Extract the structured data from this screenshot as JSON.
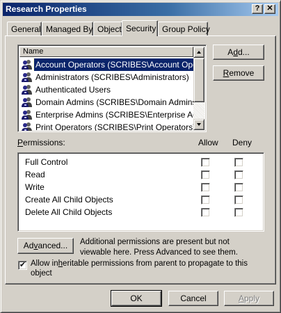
{
  "window": {
    "title": "Research Properties",
    "help_btn": "?",
    "close_btn": "✕"
  },
  "tabs": [
    {
      "label": "General",
      "active": false
    },
    {
      "label": "Managed By",
      "active": false
    },
    {
      "label": "Object",
      "active": false
    },
    {
      "label": "Security",
      "active": true
    },
    {
      "label": "Group Policy",
      "active": false
    }
  ],
  "name_list": {
    "header": "Name",
    "items": [
      {
        "label": "Account Operators (SCRIBES\\Account Opera...",
        "icon": "group-icon",
        "selected": true
      },
      {
        "label": "Administrators (SCRIBES\\Administrators)",
        "icon": "group-icon",
        "selected": false
      },
      {
        "label": "Authenticated Users",
        "icon": "group-icon",
        "selected": false
      },
      {
        "label": "Domain Admins (SCRIBES\\Domain Admins)",
        "icon": "group-icon",
        "selected": false
      },
      {
        "label": "Enterprise Admins (SCRIBES\\Enterprise Admins)",
        "icon": "group-icon",
        "selected": false
      },
      {
        "label": "Print Operators (SCRIBES\\Print Operators)",
        "icon": "group-icon",
        "selected": false
      }
    ]
  },
  "buttons": {
    "add": {
      "pre": "A",
      "ul": "d",
      "post": "d..."
    },
    "remove": {
      "pre": "",
      "ul": "R",
      "post": "emove"
    },
    "advanced": {
      "pre": "Ad",
      "ul": "v",
      "post": "anced..."
    },
    "ok": "OK",
    "cancel": "Cancel",
    "apply": {
      "pre": "",
      "ul": "A",
      "post": "pply"
    }
  },
  "permissions": {
    "label_pre": "",
    "label_ul": "P",
    "label_post": "ermissions:",
    "allow_header": "Allow",
    "deny_header": "Deny",
    "rows": [
      {
        "name": "Full Control",
        "allow": false,
        "deny": false
      },
      {
        "name": "Read",
        "allow": false,
        "deny": false
      },
      {
        "name": "Write",
        "allow": false,
        "deny": false
      },
      {
        "name": "Create All Child Objects",
        "allow": false,
        "deny": false
      },
      {
        "name": "Delete All Child Objects",
        "allow": false,
        "deny": false
      }
    ]
  },
  "advanced_note": {
    "line1": "Additional permissions are present but not",
    "line2": "viewable here. Press Advanced to see them."
  },
  "inherit": {
    "checked": true,
    "check_mark": "✔",
    "line1_pre": "Allow in",
    "line1_ul": "h",
    "line1_post": "eritable permissions from parent to propagate to this",
    "line2": "object"
  }
}
